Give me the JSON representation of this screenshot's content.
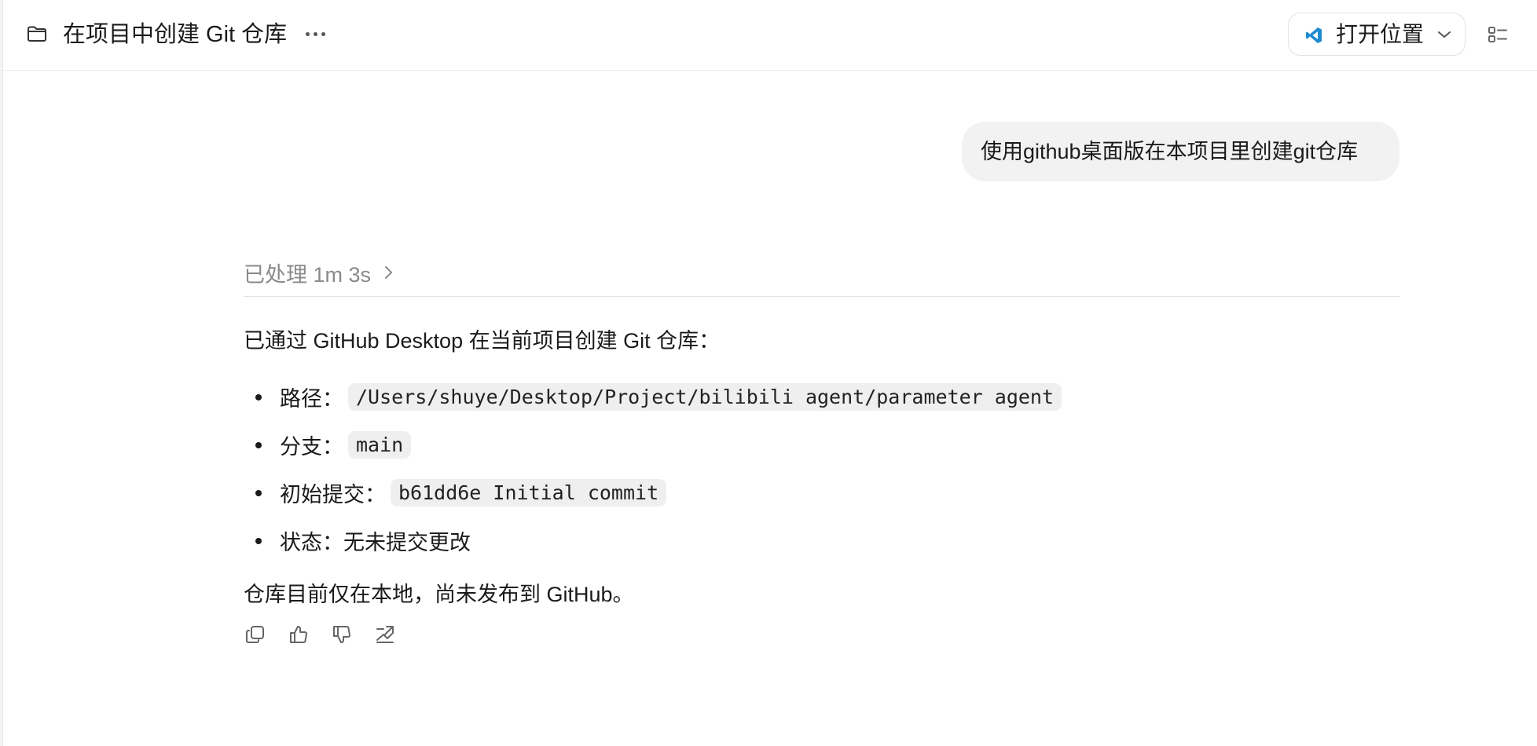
{
  "header": {
    "title": "在项目中创建 Git 仓库",
    "open_button_label": "打开位置"
  },
  "conversation": {
    "user_message": "使用github桌面版在本项目里创建git仓库",
    "processed_label": "已处理 1m 3s",
    "summary": "已通过 GitHub Desktop 在当前项目创建 Git 仓库：",
    "items": [
      {
        "label": "路径：",
        "code": "/Users/shuye/Desktop/Project/bilibili agent/parameter agent",
        "text": ""
      },
      {
        "label": "分支：",
        "code": "main",
        "text": ""
      },
      {
        "label": "初始提交：",
        "code": "b61dd6e Initial commit",
        "text": ""
      },
      {
        "label": "状态：",
        "code": "",
        "text": "无未提交更改"
      }
    ],
    "footer": "仓库目前仅在本地，尚未发布到 GitHub。"
  },
  "icons": {
    "folder": "folder-icon",
    "more": "more-horizontal-icon",
    "vscode": "vscode-icon",
    "chevron_down": "chevron-down-icon",
    "panel": "list-panel-icon",
    "copy": "copy-icon",
    "thumbs_up": "thumbs-up-icon",
    "thumbs_down": "thumbs-down-icon",
    "share": "share-icon"
  },
  "colors": {
    "vscode_blue": "#1f8ad2",
    "bubble_bg": "#f2f2f2",
    "muted_text": "#8a8a8a"
  }
}
